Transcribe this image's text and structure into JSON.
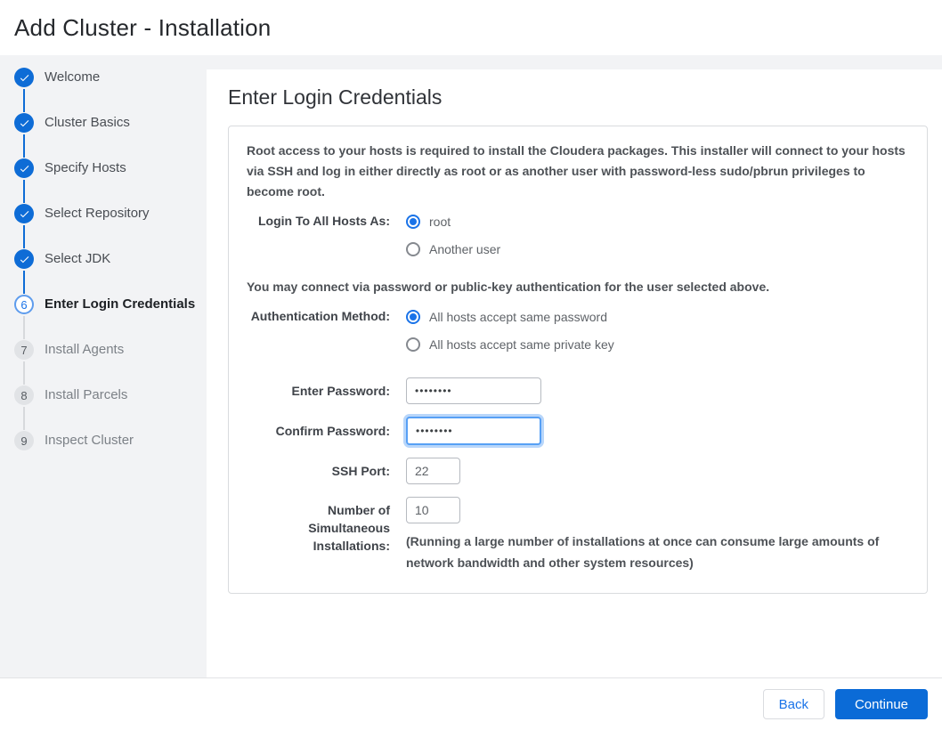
{
  "header": {
    "title": "Add Cluster - Installation"
  },
  "sidebar": {
    "steps": [
      {
        "label": "Welcome",
        "state": "done"
      },
      {
        "label": "Cluster Basics",
        "state": "done"
      },
      {
        "label": "Specify Hosts",
        "state": "done"
      },
      {
        "label": "Select Repository",
        "state": "done"
      },
      {
        "label": "Select JDK",
        "state": "done"
      },
      {
        "label": "Enter Login Credentials",
        "state": "current",
        "number": "6"
      },
      {
        "label": "Install Agents",
        "state": "todo",
        "number": "7"
      },
      {
        "label": "Install Parcels",
        "state": "todo",
        "number": "8"
      },
      {
        "label": "Inspect Cluster",
        "state": "todo",
        "number": "9"
      }
    ]
  },
  "main": {
    "heading": "Enter Login Credentials",
    "intro": "Root access to your hosts is required to install the Cloudera packages. This installer will connect to your hosts via SSH and log in either directly as root or as another user with password-less sudo/pbrun privileges to become root.",
    "login_as": {
      "label": "Login To All Hosts As:",
      "options": [
        {
          "label": "root",
          "selected": true
        },
        {
          "label": "Another user",
          "selected": false
        }
      ]
    },
    "auth_note": "You may connect via password or public-key authentication for the user selected above.",
    "auth_method": {
      "label": "Authentication Method:",
      "options": [
        {
          "label": "All hosts accept same password",
          "selected": true
        },
        {
          "label": "All hosts accept same private key",
          "selected": false
        }
      ]
    },
    "enter_password": {
      "label": "Enter Password:",
      "value": "••••••••"
    },
    "confirm_password": {
      "label": "Confirm Password:",
      "value": "••••••••",
      "focused": true
    },
    "ssh_port": {
      "label": "SSH Port:",
      "value": "22"
    },
    "simultaneous": {
      "label": "Number of Simultaneous Installations:",
      "value": "10",
      "note": "(Running a large number of installations at once can consume large amounts of network bandwidth and other system resources)"
    }
  },
  "footer": {
    "back_label": "Back",
    "continue_label": "Continue"
  },
  "colors": {
    "accent_blue": "#1a73e8",
    "step_done_blue": "#0e6cd6",
    "continue_button_blue": "#0b6bd7",
    "sidebar_bg": "#f2f3f5",
    "focus_ring": "#57a0f5"
  }
}
